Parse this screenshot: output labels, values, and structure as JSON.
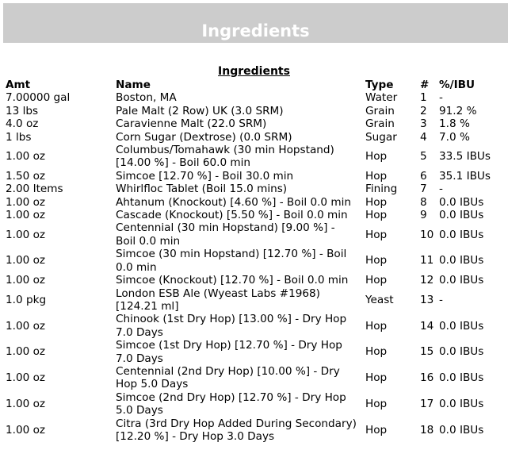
{
  "banner": "Ingredients",
  "caption": "Ingredients",
  "columns": {
    "amt": "Amt",
    "name": "Name",
    "type": "Type",
    "num": "#",
    "ibu": "%/IBU"
  },
  "rows": [
    {
      "amt": "7.00000 gal",
      "name": "Boston, MA",
      "type": "Water",
      "num": "1",
      "ibu": "-"
    },
    {
      "amt": "13 lbs",
      "name": "Pale Malt (2 Row) UK (3.0 SRM)",
      "type": "Grain",
      "num": "2",
      "ibu": "91.2 %"
    },
    {
      "amt": "4.0 oz",
      "name": "Caravienne Malt (22.0 SRM)",
      "type": "Grain",
      "num": "3",
      "ibu": "1.8 %"
    },
    {
      "amt": "1 lbs",
      "name": "Corn Sugar (Dextrose) (0.0 SRM)",
      "type": "Sugar",
      "num": "4",
      "ibu": "7.0 %"
    },
    {
      "amt": "1.00 oz",
      "name": "Columbus/Tomahawk (30 min Hopstand) [14.00 %] - Boil 60.0 min",
      "type": "Hop",
      "num": "5",
      "ibu": "33.5 IBUs"
    },
    {
      "amt": "1.50 oz",
      "name": "Simcoe [12.70 %] - Boil 30.0 min",
      "type": "Hop",
      "num": "6",
      "ibu": "35.1 IBUs"
    },
    {
      "amt": "2.00 Items",
      "name": "Whirlfloc Tablet (Boil 15.0 mins)",
      "type": "Fining",
      "num": "7",
      "ibu": "-"
    },
    {
      "amt": "1.00 oz",
      "name": "Ahtanum (Knockout) [4.60 %] - Boil 0.0 min",
      "type": "Hop",
      "num": "8",
      "ibu": "0.0 IBUs"
    },
    {
      "amt": "1.00 oz",
      "name": "Cascade (Knockout) [5.50 %] - Boil 0.0 min",
      "type": "Hop",
      "num": "9",
      "ibu": "0.0 IBUs"
    },
    {
      "amt": "1.00 oz",
      "name": "Centennial (30 min Hopstand) [9.00 %] - Boil 0.0 min",
      "type": "Hop",
      "num": "10",
      "ibu": "0.0 IBUs"
    },
    {
      "amt": "1.00 oz",
      "name": "Simcoe (30 min Hopstand) [12.70 %] - Boil 0.0 min",
      "type": "Hop",
      "num": "11",
      "ibu": "0.0 IBUs"
    },
    {
      "amt": "1.00 oz",
      "name": "Simcoe (Knockout) [12.70 %] - Boil 0.0 min",
      "type": "Hop",
      "num": "12",
      "ibu": "0.0 IBUs"
    },
    {
      "amt": "1.0 pkg",
      "name": "London ESB Ale (Wyeast Labs #1968) [124.21 ml]",
      "type": "Yeast",
      "num": "13",
      "ibu": "-"
    },
    {
      "amt": "1.00 oz",
      "name": "Chinook (1st Dry Hop) [13.00 %] - Dry Hop 7.0 Days",
      "type": "Hop",
      "num": "14",
      "ibu": "0.0 IBUs"
    },
    {
      "amt": "1.00 oz",
      "name": "Simcoe (1st Dry Hop) [12.70 %] - Dry Hop 7.0 Days",
      "type": "Hop",
      "num": "15",
      "ibu": "0.0 IBUs"
    },
    {
      "amt": "1.00 oz",
      "name": "Centennial (2nd Dry Hop) [10.00 %] - Dry Hop 5.0 Days",
      "type": "Hop",
      "num": "16",
      "ibu": "0.0 IBUs"
    },
    {
      "amt": "1.00 oz",
      "name": "Simcoe (2nd Dry Hop) [12.70 %] - Dry Hop 5.0 Days",
      "type": "Hop",
      "num": "17",
      "ibu": "0.0 IBUs"
    },
    {
      "amt": "1.00 oz",
      "name": "Citra (3rd Dry Hop Added During Secondary) [12.20 %] - Dry Hop 3.0 Days",
      "type": "Hop",
      "num": "18",
      "ibu": "0.0 IBUs"
    }
  ]
}
